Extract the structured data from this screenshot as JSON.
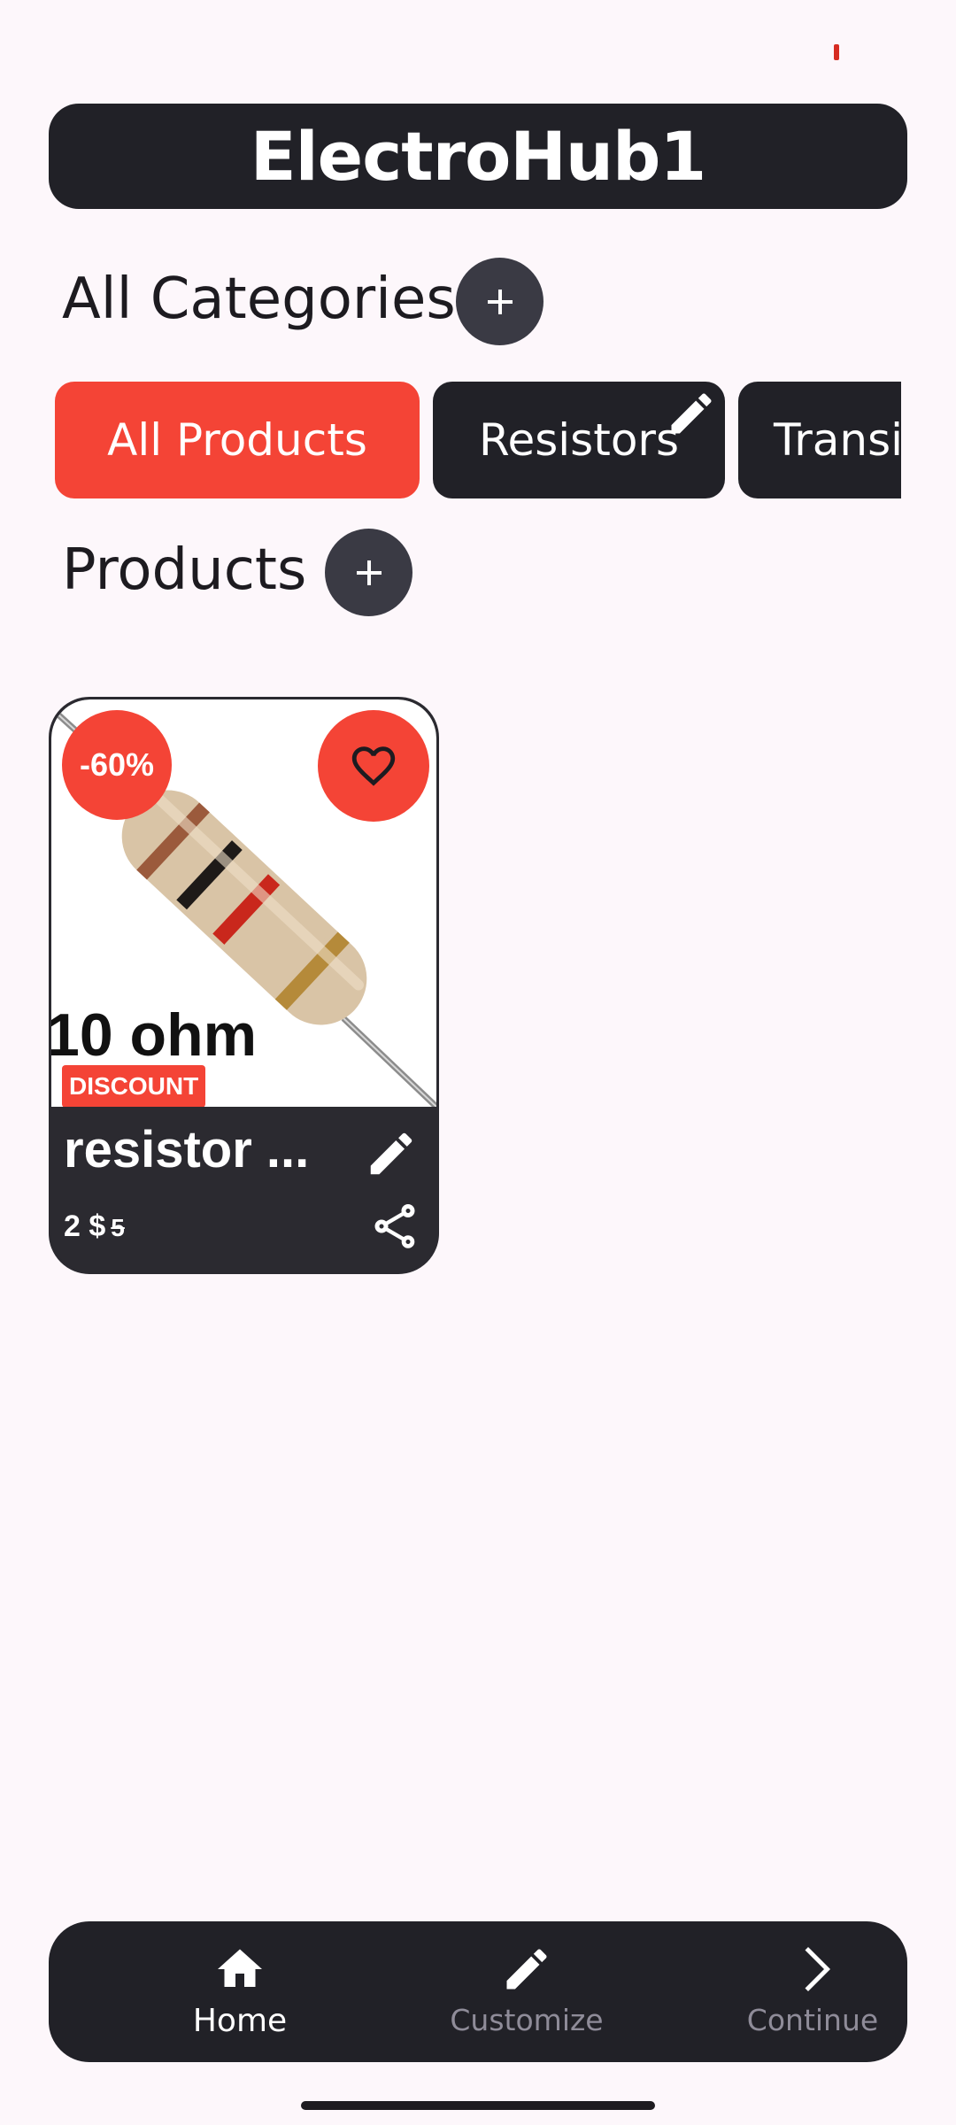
{
  "status_bar": {
    "indicator_color": "#d62c22"
  },
  "header": {
    "title": "ElectroHub1"
  },
  "categories": {
    "heading": "All Categories",
    "add_icon": "plus-icon",
    "chips": [
      {
        "label": "All Products",
        "selected": true
      },
      {
        "label": "Resistors",
        "selected": false,
        "edit_icon": "pencil-icon"
      },
      {
        "label": "Transis",
        "selected": false
      }
    ]
  },
  "products": {
    "heading": "Products",
    "add_icon": "plus-icon",
    "items": [
      {
        "image_caption": "10 ohm",
        "image_tag": "DISCOUNT",
        "discount_badge": "-60%",
        "favorite_icon": "heart-outline-icon",
        "name": "resistor ...",
        "price": "2 $",
        "old_price": "5",
        "edit_icon": "pencil-icon",
        "share_icon": "share-icon"
      }
    ]
  },
  "bottom_nav": {
    "items": [
      {
        "label": "Home",
        "icon": "home-icon",
        "active": true
      },
      {
        "label": "Customize",
        "icon": "pencil-icon",
        "active": false
      },
      {
        "label": "Continue",
        "icon": "chevron-right-icon",
        "active": false
      }
    ]
  },
  "colors": {
    "accent": "#f44436",
    "dark": "#212127",
    "background": "#fdf7fb"
  }
}
